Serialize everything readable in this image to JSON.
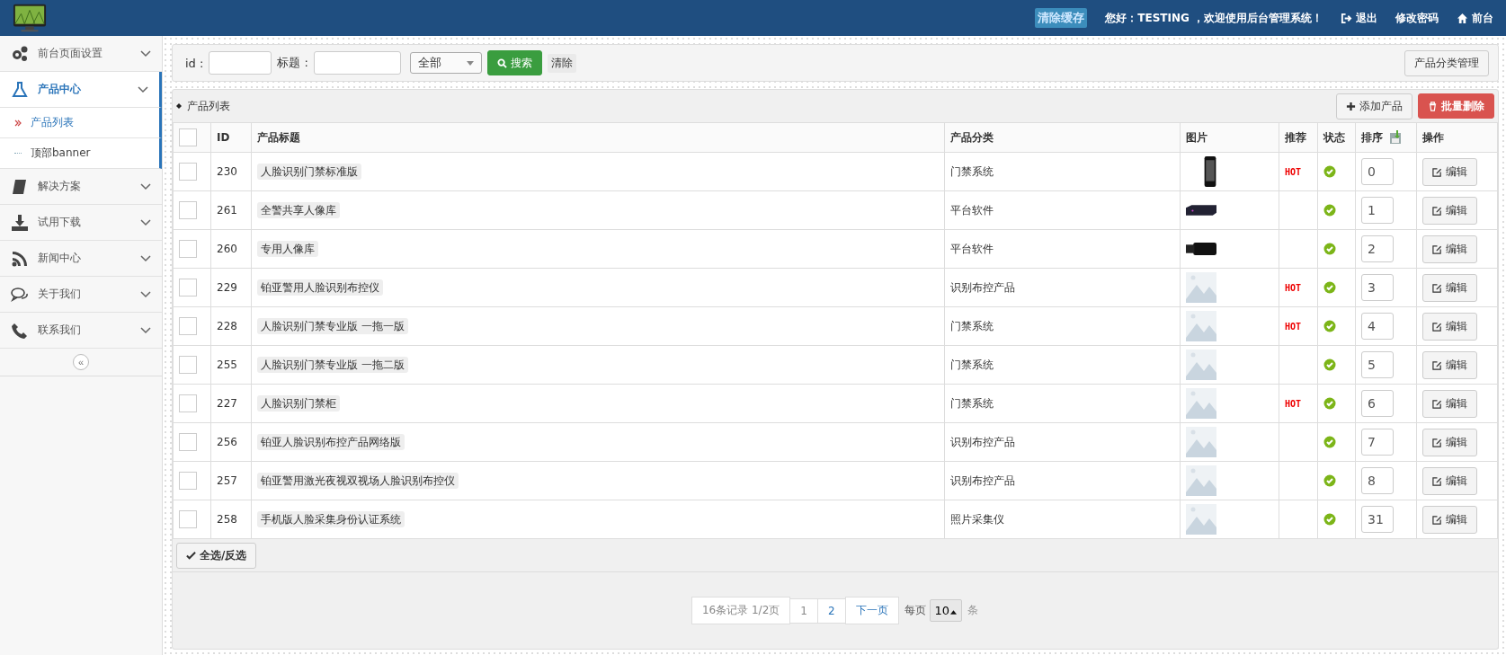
{
  "header": {
    "clear_cache": "清除缓存",
    "greeting": "您好：TESTING ，欢迎使用后台管理系统！",
    "links": [
      {
        "kind": "logout",
        "label": "退出"
      },
      {
        "kind": "password",
        "label": "修改密码"
      },
      {
        "kind": "home",
        "label": "前台"
      }
    ]
  },
  "sidebar": {
    "items": [
      {
        "kind": "gears",
        "label": "前台页面设置",
        "expanded": false
      },
      {
        "kind": "flask",
        "label": "产品中心",
        "expanded": true,
        "children": [
          {
            "label": "产品列表",
            "selected": true
          },
          {
            "label": "顶部banner",
            "selected": false
          }
        ]
      },
      {
        "kind": "book",
        "label": "解决方案",
        "expanded": false
      },
      {
        "kind": "download",
        "label": "试用下载",
        "expanded": false
      },
      {
        "kind": "rss",
        "label": "新闻中心",
        "expanded": false
      },
      {
        "kind": "chat",
        "label": "关于我们",
        "expanded": false
      },
      {
        "kind": "phone",
        "label": "联系我们",
        "expanded": false
      }
    ],
    "collapse": "«"
  },
  "search": {
    "id_label": "id :",
    "title_label": "标题 :",
    "select": "全部",
    "search_button": "搜索",
    "clear": "清除",
    "category_button": "产品分类管理"
  },
  "panel": {
    "title": "产品列表",
    "add_button": "添加产品",
    "delete_button": "批量删除"
  },
  "table": {
    "columns": [
      "ID",
      "产品标题",
      "产品分类",
      "图片",
      "推荐",
      "状态",
      "排序",
      "操作"
    ],
    "all_checked": false,
    "rows": [
      {
        "kind": "phone",
        "checked": false,
        "id": "230",
        "title": "人脸识别门禁标准版",
        "category": "门禁系统",
        "badge": "HOT",
        "enabled": true,
        "order": "0",
        "action": "编辑"
      },
      {
        "kind": "box",
        "checked": false,
        "id": "261",
        "title": "全警共享人像库",
        "category": "平台软件",
        "enabled": true,
        "order": "1",
        "action": "编辑"
      },
      {
        "kind": "camera",
        "checked": false,
        "id": "260",
        "title": "专用人像库",
        "category": "平台软件",
        "enabled": true,
        "order": "2",
        "action": "编辑"
      },
      {
        "kind": "placeholder",
        "checked": false,
        "id": "229",
        "title": "铂亚警用人脸识别布控仪",
        "category": "识别布控产品",
        "badge": "HOT",
        "enabled": true,
        "order": "3",
        "action": "编辑"
      },
      {
        "kind": "placeholder",
        "checked": false,
        "id": "228",
        "title": "人脸识别门禁专业版 一拖一版",
        "category": "门禁系统",
        "badge": "HOT",
        "enabled": true,
        "order": "4",
        "action": "编辑"
      },
      {
        "kind": "placeholder",
        "checked": false,
        "id": "255",
        "title": "人脸识别门禁专业版 一拖二版",
        "category": "门禁系统",
        "enabled": true,
        "order": "5",
        "action": "编辑"
      },
      {
        "kind": "placeholder",
        "checked": false,
        "id": "227",
        "title": "人脸识别门禁柜",
        "category": "门禁系统",
        "badge": "HOT",
        "enabled": true,
        "order": "6",
        "action": "编辑"
      },
      {
        "kind": "placeholder",
        "checked": false,
        "id": "256",
        "title": "铂亚人脸识别布控产品网络版",
        "category": "识别布控产品",
        "enabled": true,
        "order": "7",
        "action": "编辑"
      },
      {
        "kind": "placeholder",
        "checked": false,
        "id": "257",
        "title": "铂亚警用激光夜视双视场人脸识别布控仪",
        "category": "识别布控产品",
        "enabled": true,
        "order": "8",
        "action": "编辑"
      },
      {
        "kind": "placeholder",
        "checked": false,
        "id": "258",
        "title": "手机版人脸采集身份认证系统",
        "category": "照片采集仪",
        "enabled": true,
        "order": "31",
        "action": "编辑"
      }
    ]
  },
  "select_all": "全选/反选",
  "pager": {
    "summary": "16条记录 1/2页",
    "pages": [
      {
        "label": "1",
        "selected": true
      },
      {
        "label": "2",
        "selected": false
      }
    ],
    "next": "下一页",
    "per_page_label": "每页",
    "per_page": "10",
    "unit": "条"
  }
}
